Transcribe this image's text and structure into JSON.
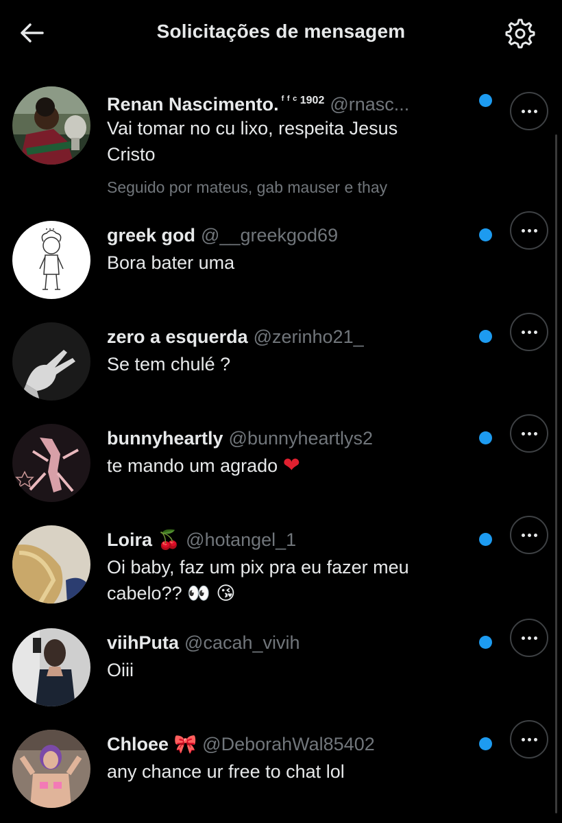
{
  "header": {
    "title": "Solicitações de mensagem",
    "back_icon": "arrow-left-icon",
    "settings_icon": "gear-icon"
  },
  "colors": {
    "background": "#000000",
    "primary_text": "#e7e9ea",
    "secondary_text": "#71767b",
    "unread_dot": "#1d9bf0"
  },
  "requests": [
    {
      "name": "Renan Nascimento.",
      "name_suffix": "ᶠ ᶠ ᶜ 1902",
      "handle": "@rnasc...",
      "message_lines": [
        "Vai tomar no cu lixo, respeita Jesus",
        "Cristo"
      ],
      "followed_by": "Seguido por mateus, gab mauser e thay",
      "unread": true
    },
    {
      "name": "greek god",
      "handle": "@__greekgod69",
      "message_lines": [
        "Bora bater uma"
      ],
      "unread": true
    },
    {
      "name": "zero a esquerda",
      "handle": "@zerinho21_",
      "message_lines": [
        "Se tem chulé ?"
      ],
      "unread": true
    },
    {
      "name": "bunnyheartly",
      "handle": "@bunnyheartlys2",
      "message_lines": [
        "te mando um agrado"
      ],
      "message_emoji": "❤",
      "unread": true
    },
    {
      "name": "Loira",
      "name_emoji": "🍒",
      "handle": "@hotangel_1",
      "message_lines": [
        "Oi baby, faz um pix pra eu fazer meu",
        "cabelo??"
      ],
      "message_emoji": "👀 😘",
      "unread": true
    },
    {
      "name": "viihPuta",
      "handle": "@cacah_vivih",
      "message_lines": [
        "Oiii"
      ],
      "unread": true
    },
    {
      "name": "Chloee",
      "name_emoji": "🎀",
      "handle": "@DeborahWal85402",
      "message_lines": [
        "any chance ur free to chat lol"
      ],
      "unread": true
    }
  ]
}
